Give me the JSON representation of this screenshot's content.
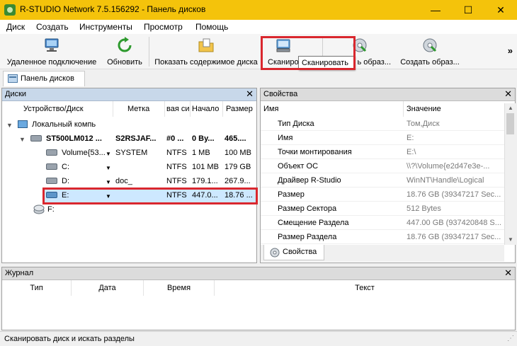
{
  "window": {
    "title": "R-STUDIO Network 7.5.156292 - Панель дисков",
    "minimize_glyph": "—",
    "maximize_glyph": "☐",
    "close_glyph": "✕"
  },
  "menu": [
    "Диск",
    "Создать",
    "Инструменты",
    "Просмотр",
    "Помощь"
  ],
  "toolbar": {
    "remote_connect": "Удаленное подключение",
    "refresh": "Обновить",
    "show_disk_contents": "Показать содержимое диска",
    "scan": "Сканиро",
    "create_image_1": "ь образ...",
    "create_image_2": "Создать образ...",
    "tooltip": "Сканировать",
    "overflow": "»"
  },
  "doc_tab": "Панель дисков",
  "disks_panel": {
    "title": "Диски",
    "columns": [
      "Устройство/Диск",
      "Метка",
      "вая си",
      "Начало",
      "Размер"
    ],
    "rows": [
      {
        "name": "Локальный компь",
        "label": "",
        "fs": "",
        "start": "",
        "size": ""
      },
      {
        "name": "ST500LM012 ...",
        "label": "S2RSJAF...",
        "fs": "#0 ...",
        "start": "0 By...",
        "size": "465...."
      },
      {
        "name": "Volume{53...",
        "label": "SYSTEM",
        "fs": "NTFS",
        "start": "1 MB",
        "size": "100 MB"
      },
      {
        "name": "C:",
        "label": "",
        "fs": "NTFS",
        "start": "101 MB",
        "size": "179 GB"
      },
      {
        "name": "D:",
        "label": "doc_",
        "fs": "NTFS",
        "start": "179.1...",
        "size": "267.9..."
      },
      {
        "name": "E:",
        "label": "",
        "fs": "NTFS",
        "start": "447.0...",
        "size": "18.76 ..."
      },
      {
        "name": "F:",
        "label": "",
        "fs": "",
        "start": "",
        "size": ""
      }
    ]
  },
  "props_panel": {
    "title": "Свойства",
    "col_name": "Имя",
    "col_value": "Значение",
    "rows": [
      {
        "name": "Тип Диска",
        "value": "Том,Диск"
      },
      {
        "name": "Имя",
        "value": "E:"
      },
      {
        "name": "Точки монтирования",
        "value": "E:\\"
      },
      {
        "name": "Объект ОС",
        "value": "\\\\?\\Volume{e2d47e3e-..."
      },
      {
        "name": "Драйвер R-Studio",
        "value": "WinNT\\Handle\\Logical"
      },
      {
        "name": "Размер",
        "value": "18.76 GB (39347217 Sec..."
      },
      {
        "name": "Размер Сектора",
        "value": "512 Bytes"
      },
      {
        "name": "Смещение Раздела",
        "value": "447.00 GB (937420848 S..."
      },
      {
        "name": "Размер Раздела",
        "value": "18.76 GB (39347217 Sec..."
      }
    ],
    "tab": "Свойства"
  },
  "log_panel": {
    "title": "Журнал",
    "columns": [
      "Тип",
      "Дата",
      "Время",
      "Текст"
    ]
  },
  "status_text": "Сканировать диск и искать разделы",
  "colors": {
    "titlebar": "#f4c30b",
    "panel_header": "#c8d8ea",
    "selection": "#cde8ff",
    "highlight": "#d9272e"
  }
}
